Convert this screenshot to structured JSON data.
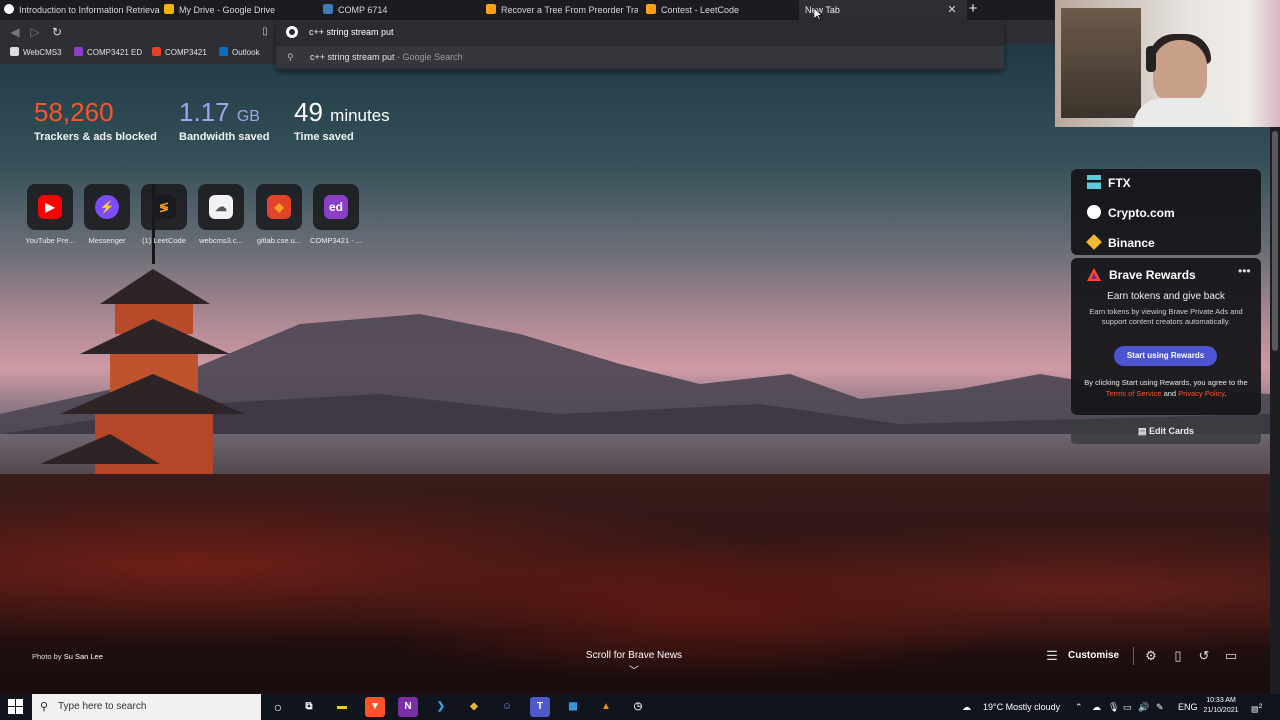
{
  "tabs": [
    {
      "title": "Introduction to Information Retrieval",
      "icon": "generic-page-icon",
      "color": "#ffffff"
    },
    {
      "title": "My Drive - Google Drive",
      "icon": "google-drive-icon",
      "color": "#f4b400"
    },
    {
      "title": "COMP 6714",
      "icon": "piazza-icon",
      "color": "#3e7ab8"
    },
    {
      "title": "Recover a Tree From Preorder Travers...",
      "icon": "leetcode-icon",
      "color": "#ffa116"
    },
    {
      "title": "Contest - LeetCode",
      "icon": "leetcode-icon",
      "color": "#ffa116"
    },
    {
      "title": "New Tab",
      "icon": "",
      "color": ""
    }
  ],
  "omnibox": {
    "query": "c++ string stream put",
    "suggestion": "c++ string stream put",
    "suggestion_engine": " - Google Search"
  },
  "bookmarks": [
    {
      "label": "WebCMS3",
      "color": "#dddddd"
    },
    {
      "label": "COMP3421 ED",
      "color": "#8b3fc9"
    },
    {
      "label": "COMP3421",
      "color": "#e2432a"
    },
    {
      "label": "Outlook",
      "color": "#0f6cbd"
    }
  ],
  "stats": {
    "trackers": {
      "value": "58,260",
      "label": "Trackers & ads blocked"
    },
    "bandwidth": {
      "value": "1.17",
      "unit": "GB",
      "label": "Bandwidth saved"
    },
    "time": {
      "value": "49",
      "unit": "minutes",
      "label": "Time saved"
    }
  },
  "top_sites": [
    {
      "label": "YouTube Pre...",
      "glyph": "▶",
      "bg": "#ff0000",
      "fg": "#ffffff"
    },
    {
      "label": "Messenger",
      "glyph": "⚡",
      "bg": "#7b4dff",
      "fg": "#ffffff"
    },
    {
      "label": "(1) LeetCode",
      "glyph": "≶",
      "bg": "#1b1b1b",
      "fg": "#ffa116"
    },
    {
      "label": "webcms3.c...",
      "glyph": "☁",
      "bg": "#f2f2f2",
      "fg": "#555555"
    },
    {
      "label": "gitlab.cse.u...",
      "glyph": "◆",
      "bg": "#e24329",
      "fg": "#fca326"
    },
    {
      "label": "COMP3421 - ...",
      "glyph": "ed",
      "bg": "#8b3fc9",
      "fg": "#ffffff"
    }
  ],
  "crypto_widgets": [
    {
      "name": "FTX",
      "icon": "ftx-icon",
      "color": "#5fcade"
    },
    {
      "name": "Crypto.com",
      "icon": "crypto-com-icon",
      "color": "#ffffff"
    },
    {
      "name": "Binance",
      "icon": "binance-icon",
      "color": "#f3ba2f"
    }
  ],
  "rewards": {
    "title": "Brave Rewards",
    "more": "•••",
    "subtitle": "Earn tokens and give back",
    "description": "Earn tokens by viewing Brave Private Ads and support content creators automatically.",
    "button": "Start using Rewards",
    "terms_prefix": "By clicking Start using Rewards, you agree to the",
    "terms_link": "Terms of Service",
    "terms_and": "and",
    "privacy_link": "Privacy Policy",
    "terms_suffix": "."
  },
  "edit_cards": "Edit Cards",
  "photo_credit": {
    "prefix": "Photo by",
    "author": "Su San Lee"
  },
  "scroll_news": "Scroll for Brave News",
  "customise": "Customise",
  "taskbar": {
    "search_placeholder": "Type here to search",
    "weather": "19°C  Mostly cloudy",
    "language": "ENG",
    "time": "10:33 AM",
    "date": "21/10/2021",
    "notifications": "2"
  },
  "accent_colors": {
    "trackers": "#fb542b",
    "bandwidth": "#a0a5eb",
    "rewards_button": "#4c54d2",
    "link": "#f5572b"
  }
}
